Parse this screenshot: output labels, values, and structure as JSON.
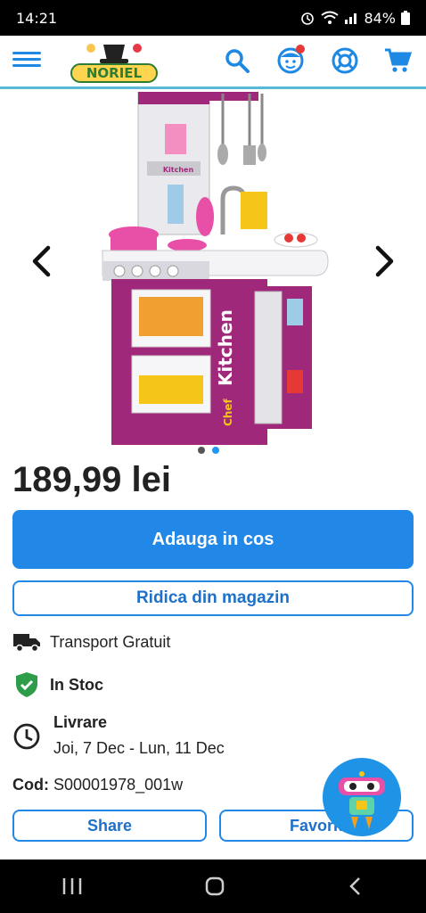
{
  "status_bar": {
    "time": "14:21",
    "battery": "84%"
  },
  "header": {
    "logo_text": "NORIEL",
    "icons": [
      "menu-icon",
      "search-icon",
      "account-icon",
      "help-icon",
      "cart-icon"
    ],
    "accent_color": "#1e88e5"
  },
  "product": {
    "image_labels": [
      "Chef Kitchen",
      "Kitchen",
      "Chef"
    ],
    "carousel": {
      "slide_count": 2,
      "active_index": 1
    },
    "price": "189,99 lei",
    "add_to_cart_label": "Adauga in cos",
    "pickup_label": "Ridica din magazin",
    "transport_label": "Transport Gratuit",
    "stock_label": "In Stoc",
    "delivery_title": "Livrare",
    "delivery_dates": "Joi, 7 Dec - Lun, 11 Dec",
    "code_label": "Cod:",
    "code_value": "S00001978_001w",
    "share_label": "Share",
    "favorite_label": "Favorit"
  },
  "colors": {
    "primary": "#2288e8",
    "stock_green": "#2e7d32",
    "kitchen_purple": "#a0287a"
  }
}
